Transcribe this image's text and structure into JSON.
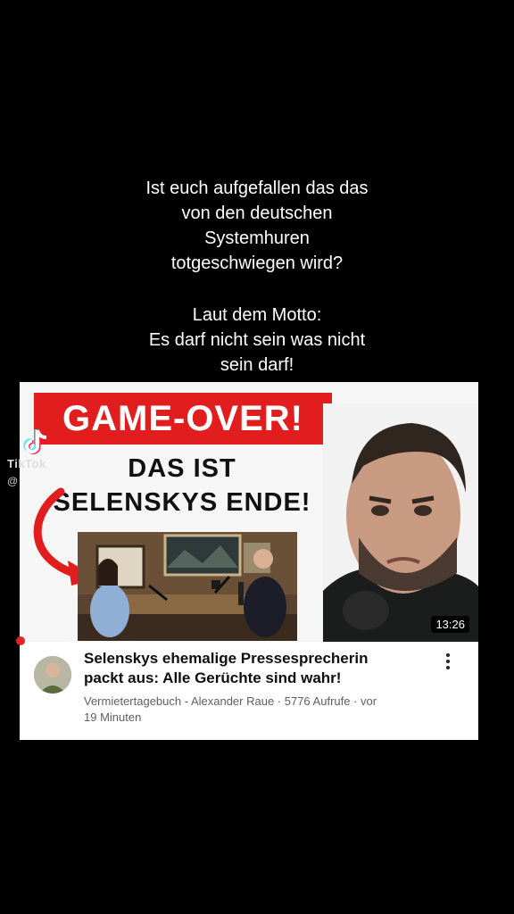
{
  "caption": {
    "lines1": [
      "Ist euch aufgefallen das das",
      "von den deutschen",
      "Systemhuren",
      "totgeschwiegen wird?"
    ],
    "lines2": [
      "Laut dem Motto:",
      "Es darf nicht sein was nicht",
      "sein darf!"
    ]
  },
  "watermark": {
    "brand": "TikTok",
    "handle": "@"
  },
  "video": {
    "thumbnail": {
      "banner": "GAME-OVER!",
      "headline": [
        "DAS IST",
        "SELENSKYS ENDE!"
      ],
      "duration": "13:26"
    },
    "title": [
      "Selenskys ehemalige Pressesprecherin",
      "packt aus: Alle Gerüchte sind wahr!"
    ],
    "meta": [
      "Vermietertagebuch - Alexander Raue · 5776 Aufrufe · vor",
      "19 Minuten"
    ]
  },
  "colors": {
    "banner_red": "#e21d1d",
    "background": "#000000"
  }
}
